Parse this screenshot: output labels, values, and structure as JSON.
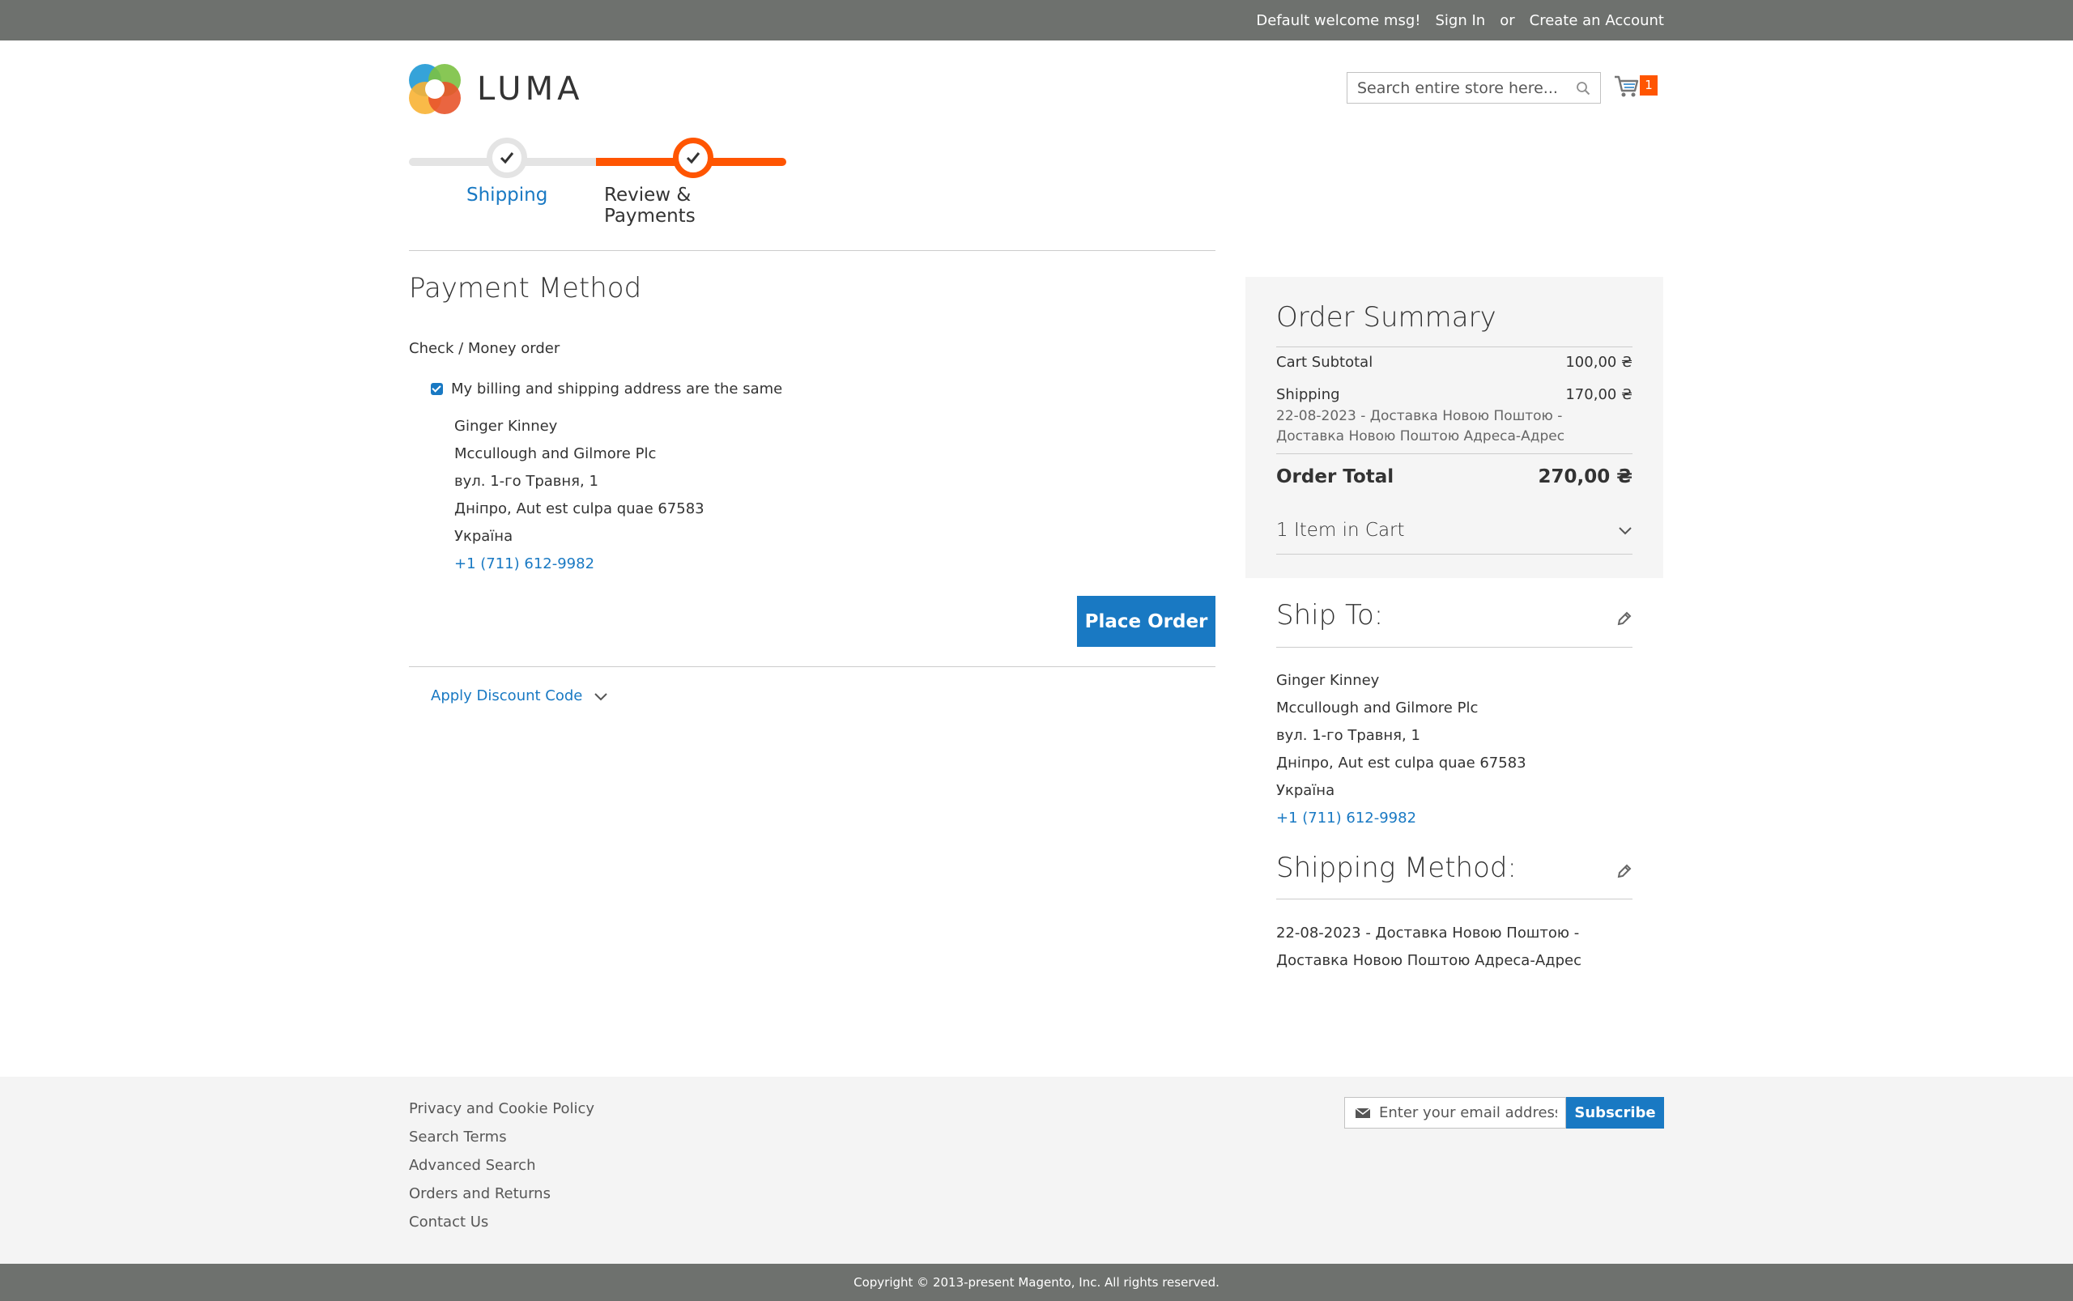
{
  "topbar": {
    "welcome": "Default welcome msg!",
    "sign_in": "Sign In",
    "or": "or",
    "create_account": "Create an Account"
  },
  "header": {
    "logo_text": "LUMA",
    "search_placeholder": "Search entire store here...",
    "cart_count": "1"
  },
  "progress": {
    "steps": [
      {
        "label": "Shipping",
        "state": "complete"
      },
      {
        "label": "Review & Payments",
        "state": "active"
      }
    ]
  },
  "payment": {
    "title": "Payment Method",
    "method": "Check / Money order",
    "billing_same_label": "My billing and shipping address are the same",
    "billing_same_checked": true,
    "address": {
      "name": "Ginger Kinney",
      "company": "Mccullough and Gilmore Plc",
      "street": "вул. 1-го Травня, 1",
      "city_line": "Дніпро, Aut est culpa quae 67583",
      "country": "Україна",
      "phone": "+1 (711) 612-9982"
    },
    "place_order": "Place Order",
    "discount_label": "Apply Discount Code"
  },
  "summary": {
    "title": "Order Summary",
    "subtotal_label": "Cart Subtotal",
    "subtotal_value": "100,00 ₴",
    "shipping_label": "Shipping",
    "shipping_value": "170,00 ₴",
    "shipping_desc": "22-08-2023 - Доставка Новою Поштою - Доставка Новою Поштою Адреса-Адрес",
    "total_label": "Order Total",
    "total_value": "270,00 ₴",
    "items_label": "1 Item in Cart"
  },
  "ship_to": {
    "title": "Ship To:",
    "name": "Ginger Kinney",
    "company": "Mccullough and Gilmore Plc",
    "street": "вул. 1-го Травня, 1",
    "city_line": "Дніпро, Aut est culpa quae 67583",
    "country": "Україна",
    "phone": "+1 (711) 612-9982"
  },
  "shipping_method": {
    "title": "Shipping Method:",
    "value": "22-08-2023 - Доставка Новою Поштою - Доставка Новою Поштою Адреса-Адрес"
  },
  "footer": {
    "links": [
      "Privacy and Cookie Policy",
      "Search Terms",
      "Advanced Search",
      "Orders and Returns",
      "Contact Us"
    ],
    "newsletter_placeholder": "Enter your email address",
    "subscribe": "Subscribe",
    "copyright": "Copyright © 2013-present Magento, Inc. All rights reserved."
  },
  "colors": {
    "accent_blue": "#1979c3",
    "accent_orange": "#ff5501",
    "topbar_gray": "#6e716e"
  }
}
